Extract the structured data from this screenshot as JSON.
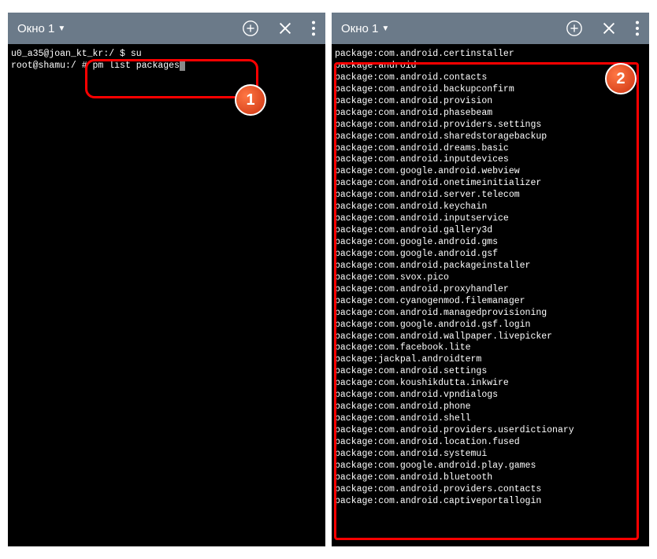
{
  "left": {
    "title": "Окно 1",
    "line1_prefix": "u0_a35@joan_kt_kr:/ $ ",
    "line1_cmd": "su",
    "line2_prefix": "root@shamu:/ # ",
    "line2_cmd": "pm list packages"
  },
  "right": {
    "title": "Окно 1",
    "packages": [
      "package:com.android.certinstaller",
      "package:android",
      "package:com.android.contacts",
      "package:com.android.backupconfirm",
      "package:com.android.provision",
      "package:com.android.phasebeam",
      "package:com.android.providers.settings",
      "package:com.android.sharedstoragebackup",
      "package:com.android.dreams.basic",
      "package:com.android.inputdevices",
      "package:com.google.android.webview",
      "package:com.android.onetimeinitializer",
      "package:com.android.server.telecom",
      "package:com.android.keychain",
      "package:com.android.inputservice",
      "package:com.android.gallery3d",
      "package:com.google.android.gms",
      "package:com.google.android.gsf",
      "package:com.android.packageinstaller",
      "package:com.svox.pico",
      "package:com.android.proxyhandler",
      "package:com.cyanogenmod.filemanager",
      "package:com.android.managedprovisioning",
      "package:com.google.android.gsf.login",
      "package:com.android.wallpaper.livepicker",
      "package:com.facebook.lite",
      "package:jackpal.androidterm",
      "package:com.android.settings",
      "package:com.koushikdutta.inkwire",
      "package:com.android.vpndialogs",
      "package:com.android.phone",
      "package:com.android.shell",
      "package:com.android.providers.userdictionary",
      "package:com.android.location.fused",
      "package:com.android.systemui",
      "package:com.google.android.play.games",
      "package:com.android.bluetooth",
      "package:com.android.providers.contacts",
      "package:com.android.captiveportallogin"
    ]
  },
  "badges": {
    "one": "1",
    "two": "2"
  }
}
